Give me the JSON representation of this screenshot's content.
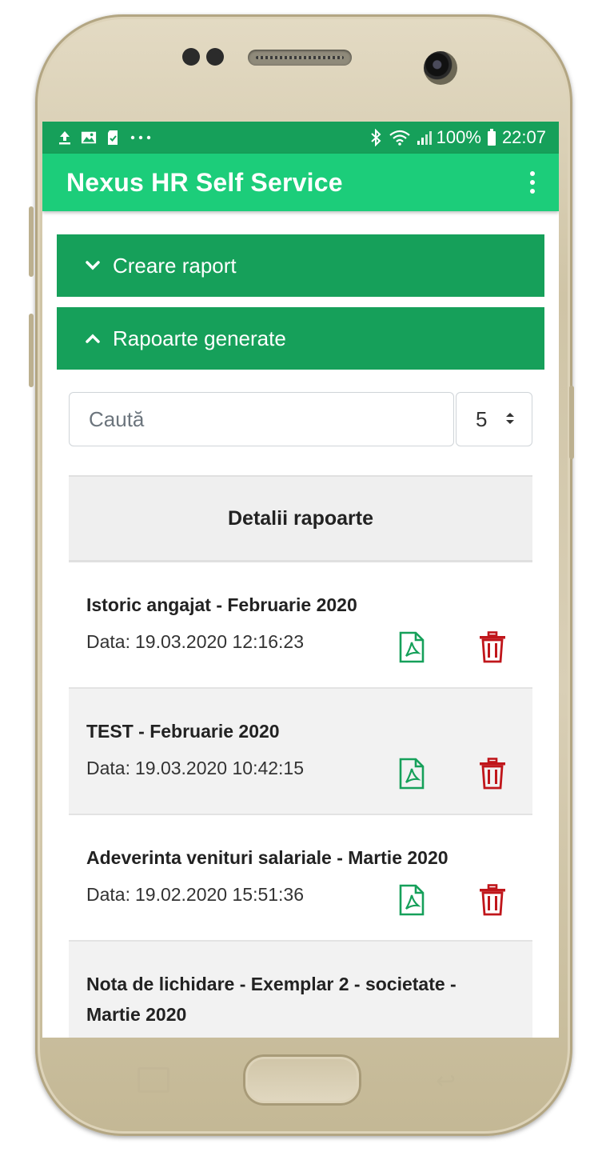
{
  "status_bar": {
    "battery": "100%",
    "time": "22:07",
    "left_icons": [
      "upload-icon",
      "image-icon",
      "sim-icon",
      "more-icon"
    ],
    "right_icons": [
      "bluetooth-icon",
      "wifi-icon",
      "signal-icon",
      "battery-icon"
    ]
  },
  "app_bar": {
    "title": "Nexus HR Self Service",
    "menu_icon": "more-vert-icon"
  },
  "accordions": [
    {
      "label": "Creare raport",
      "state": "collapsed",
      "icon": "chevron-down-icon"
    },
    {
      "label": "Rapoarte generate",
      "state": "expanded",
      "icon": "chevron-up-icon"
    }
  ],
  "filters": {
    "search_placeholder": "Caută",
    "page_size": "5"
  },
  "table": {
    "header": "Detalii rapoarte",
    "date_label": "Data:",
    "rows": [
      {
        "title": "Istoric angajat - Februarie 2020",
        "date": "19.03.2020 12:16:23"
      },
      {
        "title": "TEST - Februarie 2020",
        "date": "19.03.2020 10:42:15"
      },
      {
        "title": "Adeverinta venituri salariale - Martie 2020",
        "date": "19.02.2020 15:51:36"
      },
      {
        "title": "Nota de lichidare - Exemplar 2 - societate - Martie 2020",
        "date": ""
      }
    ]
  },
  "colors": {
    "status_bar": "#16a05a",
    "app_bar": "#1ccd7a",
    "accordion": "#16a05a",
    "pdf_icon": "#16a05a",
    "trash_icon": "#c0161b"
  }
}
